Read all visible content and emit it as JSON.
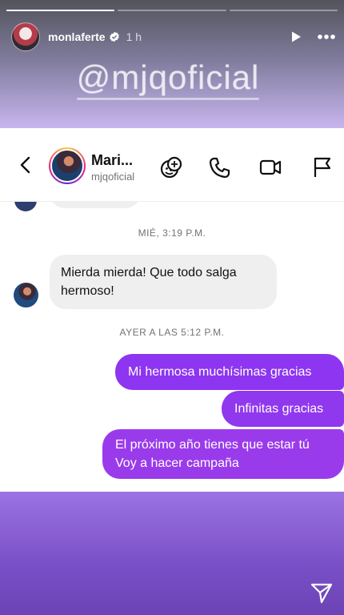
{
  "story": {
    "progress": [
      1.0,
      0.0,
      0.0
    ],
    "username": "monlaferte",
    "time": "1 h",
    "mention": "@mjqoficial"
  },
  "chat": {
    "name": "Mari...",
    "handle": "mjqoficial",
    "messages": [
      {
        "type": "timestamp",
        "text": "MIÉ, 3:19 P.M."
      },
      {
        "type": "incoming",
        "text": "Mierda mierda! Que todo salga hermoso!"
      },
      {
        "type": "timestamp",
        "text": "AYER A LAS 5:12 P.M."
      },
      {
        "type": "outgoing",
        "text": "Mi hermosa muchísimas gracias"
      },
      {
        "type": "outgoing",
        "text": "Infinitas gracias"
      },
      {
        "type": "outgoing",
        "text": "El próximo año tienes que estar tú Voy a hacer campaña"
      }
    ]
  },
  "colors": {
    "outgoing_bubble": "#8d35f0",
    "incoming_bubble": "#efefef",
    "story_bottom": "#7a4fc6"
  },
  "icons": [
    "back-chevron-icon",
    "sticker-icon",
    "phone-icon",
    "video-icon",
    "flag-icon",
    "play-icon",
    "more-icon",
    "verified-icon",
    "send-icon"
  ]
}
